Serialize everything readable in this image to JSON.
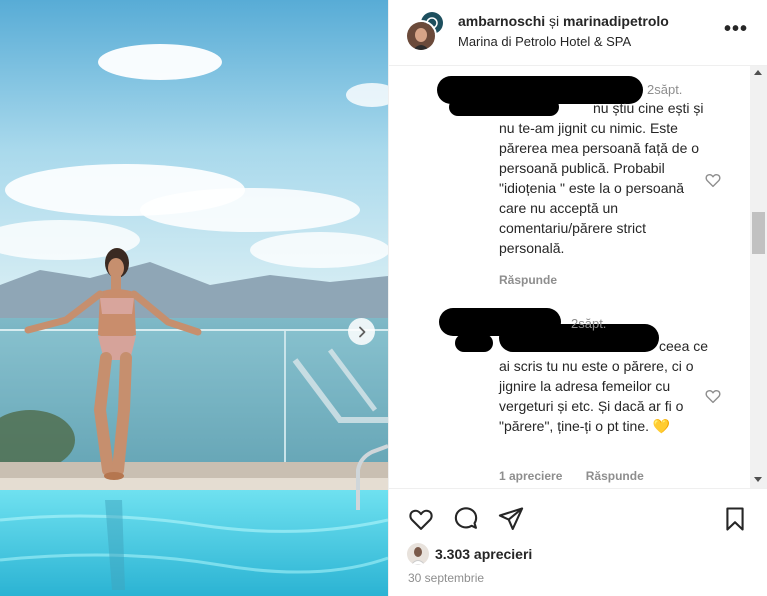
{
  "header": {
    "user1": "ambarnoschi",
    "conjunction": "și",
    "user2": "marinadipetrolo",
    "location": "Marina di Petrolo Hotel & SPA",
    "more_label": "•••"
  },
  "photo": {
    "next_icon": "chevron-right-icon"
  },
  "comments": [
    {
      "time": "2săpt.",
      "text": "nu știu cine ești și nu te-am jignit cu nimic. Este părerea mea persoană față de o persoană publică. Probabil \"idioțenia \" este la o persoană care nu acceptă un comentariu/părere strict personală.",
      "reply_label": "Răspunde",
      "like_icon": "heart-outline-icon"
    },
    {
      "time": "2săpt.",
      "text": "ceea ce ai scris tu nu este o părere, ci o jignire la adresa femeilor cu vergeturi și etc. Și dacă ar fi o \"părere\", ține-ți o pt tine. 💛",
      "likes_label": "1 apreciere",
      "reply_label": "Răspunde",
      "like_icon": "heart-outline-icon"
    }
  ],
  "actions": {
    "like_icon": "heart-outline-icon",
    "comment_icon": "speech-bubble-icon",
    "share_icon": "paper-plane-icon",
    "save_icon": "bookmark-icon",
    "likes_count": "3.303 aprecieri",
    "date": "30 septembrie"
  },
  "colors": {
    "text": "#262626",
    "muted": "#8e8e8e",
    "border": "#efefef",
    "sky": "#7cc3df",
    "pool": "#5fd0e6"
  }
}
